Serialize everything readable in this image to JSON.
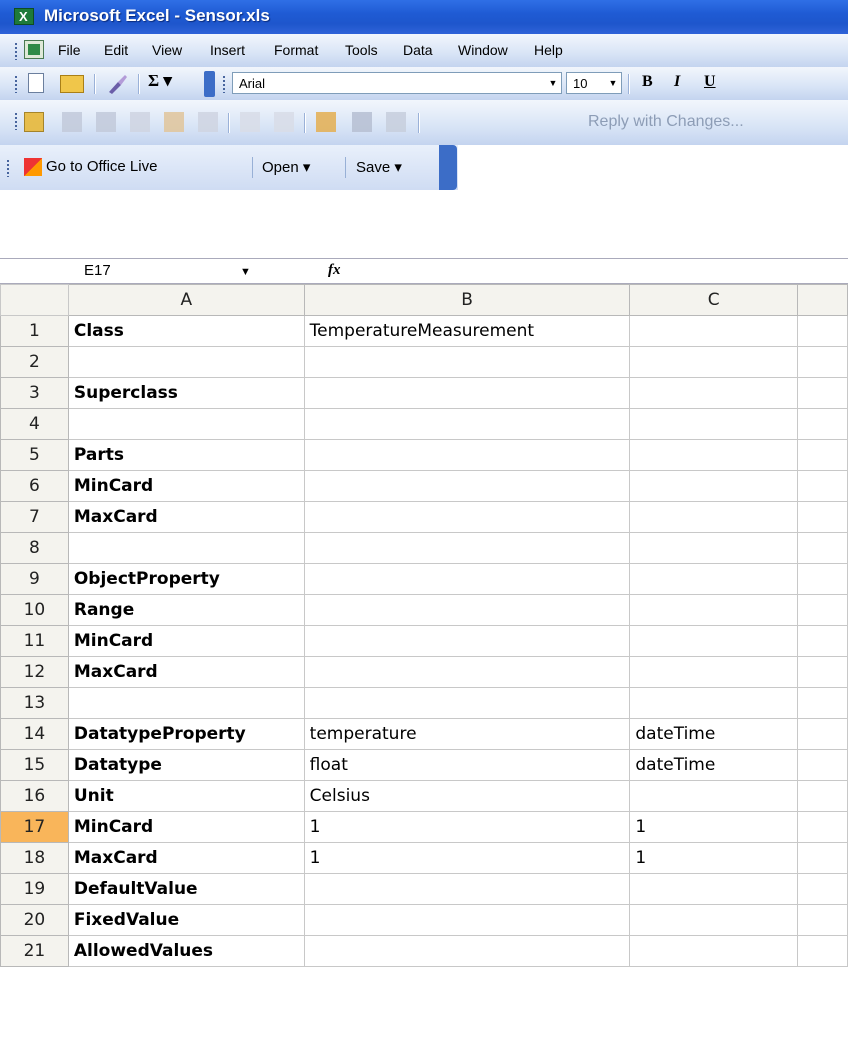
{
  "window": {
    "title": "Microsoft Excel - Sensor.xls"
  },
  "menu": [
    "File",
    "Edit",
    "View",
    "Insert",
    "Format",
    "Tools",
    "Data",
    "Window",
    "Help"
  ],
  "toolbar": {
    "sigma": "Σ ▾",
    "font": "Arial",
    "size": "10",
    "bold": "B",
    "italic": "I",
    "underline": "U",
    "reply": "Reply with Changes..."
  },
  "office_bar": {
    "live": "Go to Office Live",
    "open": "Open ▾",
    "save": "Save ▾"
  },
  "formula_bar": {
    "name_box": "E17",
    "fx": "fx",
    "formula": ""
  },
  "sheet": {
    "columns": [
      "A",
      "B",
      "C"
    ],
    "active_row": 17,
    "rows": [
      {
        "num": "1",
        "a": "Class",
        "b": "TemperatureMeasurement",
        "c": ""
      },
      {
        "num": "2",
        "a": "",
        "b": "",
        "c": ""
      },
      {
        "num": "3",
        "a": "Superclass",
        "b": "",
        "c": ""
      },
      {
        "num": "4",
        "a": "",
        "b": "",
        "c": ""
      },
      {
        "num": "5",
        "a": "Parts",
        "b": "",
        "c": ""
      },
      {
        "num": "6",
        "a": "MinCard",
        "b": "",
        "c": ""
      },
      {
        "num": "7",
        "a": "MaxCard",
        "b": "",
        "c": ""
      },
      {
        "num": "8",
        "a": "",
        "b": "",
        "c": ""
      },
      {
        "num": "9",
        "a": "ObjectProperty",
        "b": "",
        "c": ""
      },
      {
        "num": "10",
        "a": "Range",
        "b": "",
        "c": ""
      },
      {
        "num": "11",
        "a": "MinCard",
        "b": "",
        "c": ""
      },
      {
        "num": "12",
        "a": "MaxCard",
        "b": "",
        "c": ""
      },
      {
        "num": "13",
        "a": "",
        "b": "",
        "c": ""
      },
      {
        "num": "14",
        "a": "DatatypeProperty",
        "b": "temperature",
        "c": "dateTime"
      },
      {
        "num": "15",
        "a": "Datatype",
        "b": "float",
        "c": "dateTime"
      },
      {
        "num": "16",
        "a": "Unit",
        "b": "Celsius",
        "c": ""
      },
      {
        "num": "17",
        "a": "MinCard",
        "b": "1",
        "c": "1"
      },
      {
        "num": "18",
        "a": "MaxCard",
        "b": "1",
        "c": "1"
      },
      {
        "num": "19",
        "a": "DefaultValue",
        "b": "",
        "c": ""
      },
      {
        "num": "20",
        "a": "FixedValue",
        "b": "",
        "c": ""
      },
      {
        "num": "21",
        "a": "AllowedValues",
        "b": "",
        "c": ""
      }
    ]
  }
}
